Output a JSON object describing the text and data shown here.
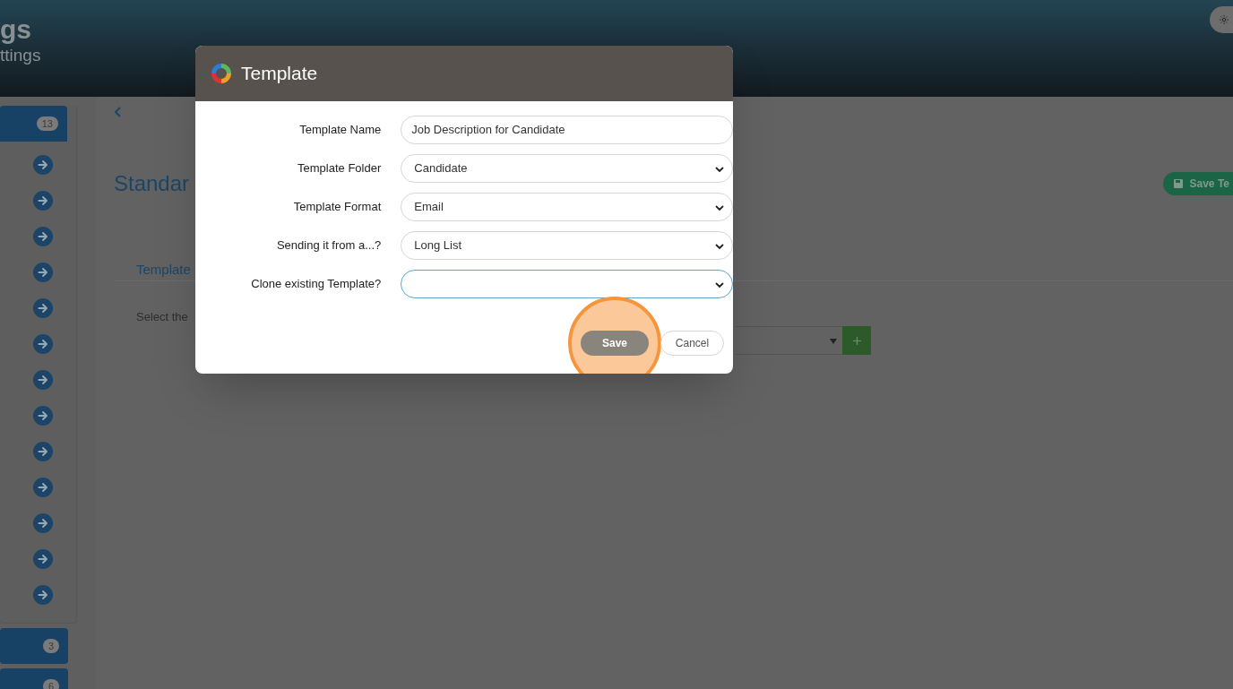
{
  "header": {
    "title": "gs",
    "subtitle": "ttings"
  },
  "sidebar": {
    "groups": [
      {
        "count": "13",
        "expanded": true,
        "items": [
          {
            "kind": "link"
          },
          {
            "kind": "link"
          },
          {
            "kind": "link"
          },
          {
            "kind": "link"
          },
          {
            "kind": "link"
          },
          {
            "kind": "link"
          },
          {
            "kind": "link"
          },
          {
            "kind": "link"
          },
          {
            "kind": "link"
          },
          {
            "kind": "link"
          },
          {
            "kind": "link"
          },
          {
            "kind": "link"
          },
          {
            "kind": "link"
          }
        ]
      },
      {
        "count": "3",
        "expanded": false
      },
      {
        "count": "6",
        "expanded": false
      }
    ]
  },
  "main": {
    "title": "Standar",
    "save_button": "Save Te",
    "tab": "Template",
    "hint": "Select the"
  },
  "modal": {
    "title": "Template",
    "fields": [
      {
        "kind": "text",
        "label": "Template Name",
        "value": "Job Description for Candidate",
        "focused": false
      },
      {
        "kind": "select",
        "label": "Template Folder",
        "value": "Candidate",
        "focused": false
      },
      {
        "kind": "select",
        "label": "Template Format",
        "value": "Email",
        "focused": false
      },
      {
        "kind": "select",
        "label": "Sending it from a...?",
        "value": "Long List",
        "focused": false
      },
      {
        "kind": "select",
        "label": "Clone existing Template?",
        "focused": true
      }
    ],
    "buttons": [
      {
        "kind": "primary",
        "label": "Save",
        "highlighted": true
      },
      {
        "kind": "secondary",
        "label": "Cancel",
        "highlighted": false
      }
    ]
  }
}
